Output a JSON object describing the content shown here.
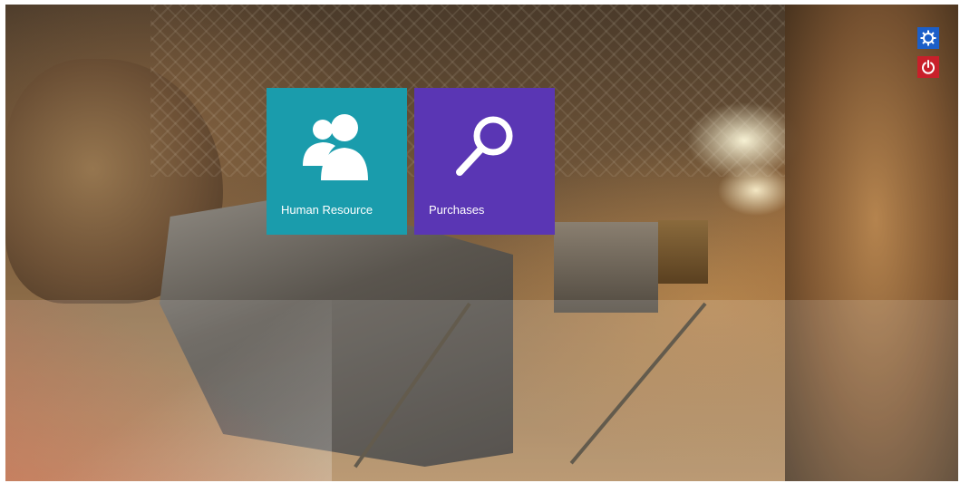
{
  "tiles": [
    {
      "label": "Human Resource",
      "icon": "users-icon",
      "color": "#1a9cac"
    },
    {
      "label": "Purchases",
      "icon": "search-icon",
      "color": "#5a36b4"
    }
  ],
  "system_buttons": [
    {
      "icon": "gear-icon",
      "color": "#1c5fc9"
    },
    {
      "icon": "power-icon",
      "color": "#c8202a"
    }
  ]
}
